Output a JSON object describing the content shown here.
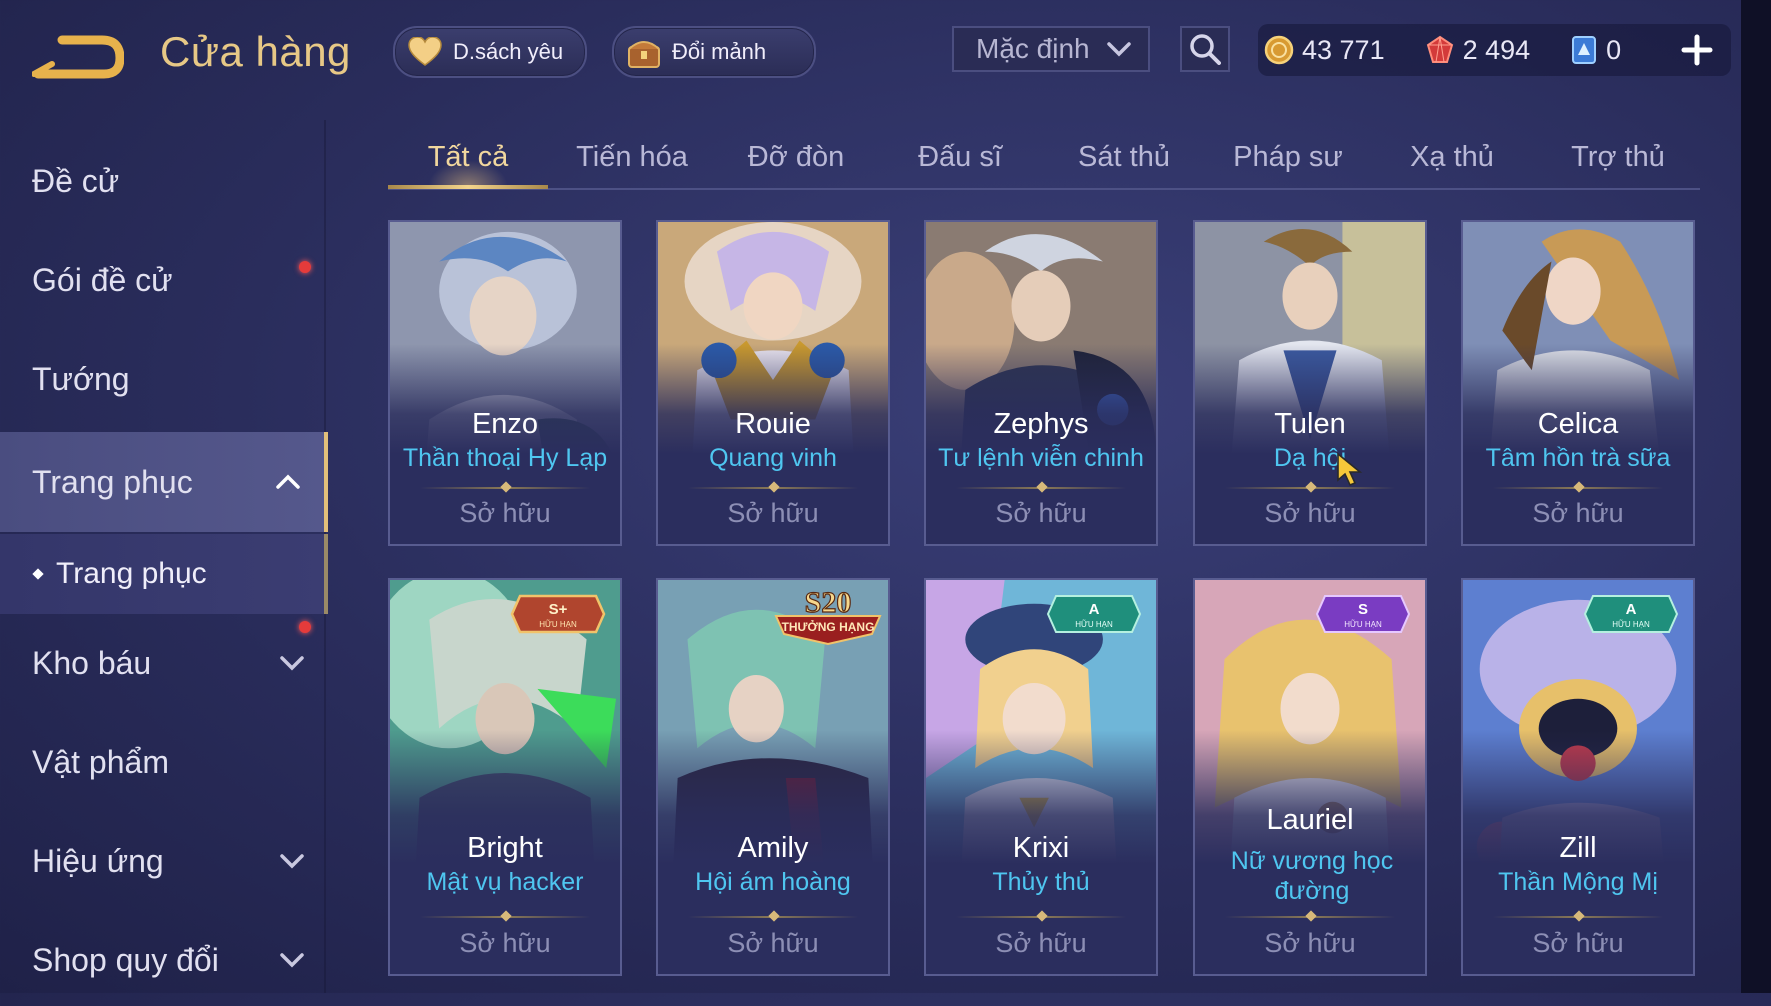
{
  "header": {
    "title": "Cửa hàng",
    "favorites_label": "D.sách yêu",
    "swap_label": "Đổi mảnh",
    "sort_value": "Mặc định",
    "currency": {
      "gold": "43 771",
      "vouchers": "2 494",
      "gems": "0"
    }
  },
  "sidebar": {
    "items": [
      {
        "label": "Đề cử"
      },
      {
        "label": "Gói đề cử"
      },
      {
        "label": "Tướng"
      },
      {
        "label": "Trang phục"
      },
      {
        "label": "Trang phục"
      },
      {
        "label": "Kho báu"
      },
      {
        "label": "Vật phẩm"
      },
      {
        "label": "Hiệu ứng"
      },
      {
        "label": "Shop quy đổi"
      }
    ]
  },
  "tabs": [
    "Tất cả",
    "Tiến hóa",
    "Đỡ đòn",
    "Đấu sĩ",
    "Sát thủ",
    "Pháp sư",
    "Xạ thủ",
    "Trợ thủ"
  ],
  "cards": [
    {
      "hero": "Enzo",
      "skin": "Thần thoại Hy Lạp",
      "status": "Sở hữu"
    },
    {
      "hero": "Rouie",
      "skin": "Quang vinh",
      "status": "Sở hữu"
    },
    {
      "hero": "Zephys",
      "skin": "Tư lệnh viễn chinh",
      "status": "Sở hữu"
    },
    {
      "hero": "Tulen",
      "skin": "Dạ hội",
      "status": "Sở hữu"
    },
    {
      "hero": "Celica",
      "skin": "Tâm hồn trà sữa",
      "status": "Sở hữu"
    },
    {
      "hero": "Bright",
      "skin": "Mật vụ hacker",
      "status": "Sở hữu",
      "badge": {
        "tier": "S+",
        "note": "HỮU HẠN"
      }
    },
    {
      "hero": "Amily",
      "skin": "Hội ám hoàng",
      "status": "Sở hữu",
      "badge": {
        "tier": "S20",
        "note": "THƯỞNG HẠNG"
      }
    },
    {
      "hero": "Krixi",
      "skin": "Thủy thủ",
      "status": "Sở hữu",
      "badge": {
        "tier": "A",
        "note": "HỮU HẠN"
      }
    },
    {
      "hero": "Lauriel",
      "skin": "Nữ vương học đường",
      "status": "Sở hữu",
      "badge": {
        "tier": "S",
        "note": "HỮU HẠN"
      }
    },
    {
      "hero": "Zill",
      "skin": "Thần Mộng Mị",
      "status": "Sở hữu",
      "badge": {
        "tier": "A",
        "note": "HỮU HẠN"
      }
    }
  ],
  "colors": {
    "accent_gold": "#e7c886",
    "skin_blue": "#4fc6f0",
    "notification_red": "#e53b3b"
  },
  "icons": [
    "back-icon",
    "heart-icon",
    "chest-icon",
    "chevron-down-icon",
    "search-icon",
    "gold-coin-icon",
    "voucher-gem-icon",
    "diamond-card-icon",
    "plus-icon",
    "chevron-up-icon",
    "mouse-cursor-icon"
  ]
}
